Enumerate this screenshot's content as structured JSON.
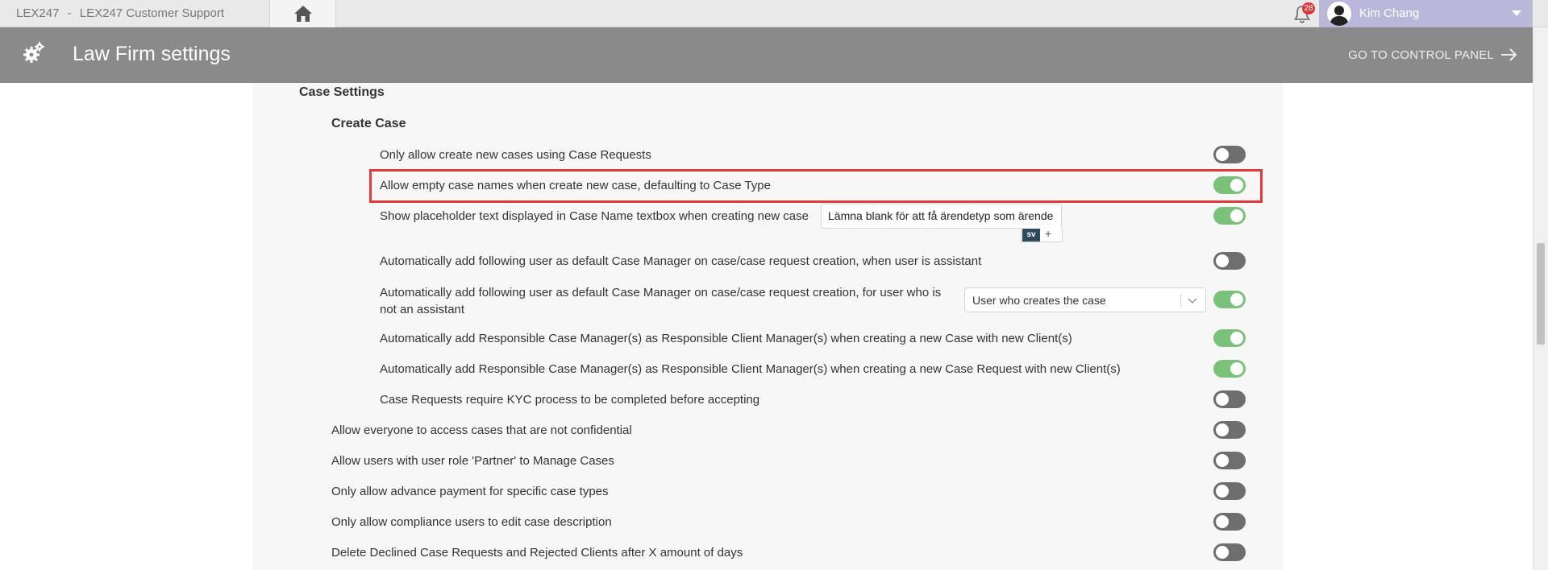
{
  "topbar": {
    "app_name": "LEX247",
    "separator": "-",
    "org_name": "LEX247 Customer Support",
    "notification_count": "28",
    "user_name": "Kim Chang"
  },
  "header": {
    "title": "Law Firm settings",
    "control_panel_label": "GO TO CONTROL PANEL"
  },
  "sections": {
    "case_settings": "Case Settings",
    "create_case": "Create Case"
  },
  "settings": [
    {
      "label": "Only allow create new cases using Case Requests",
      "enabled": false
    },
    {
      "label": "Allow empty case names when create new case, defaulting to Case Type",
      "enabled": true
    },
    {
      "label": "Show placeholder text displayed in Case Name textbox when creating new case",
      "enabled": true
    },
    {
      "label": "Automatically add following user as default Case Manager on case/case request creation, when user is assistant",
      "enabled": false
    },
    {
      "label": "Automatically add following user as default Case Manager on case/case request creation, for user who is not an assistant",
      "enabled": true
    },
    {
      "label": "Automatically add Responsible Case Manager(s) as Responsible Client Manager(s) when creating a new Case with new Client(s)",
      "enabled": true
    },
    {
      "label": "Automatically add Responsible Case Manager(s) as Responsible Client Manager(s) when creating a new Case Request with new Client(s)",
      "enabled": true
    },
    {
      "label": "Case Requests require KYC process to be completed before accepting",
      "enabled": false
    },
    {
      "label": "Allow everyone to access cases that are not confidential",
      "enabled": false
    },
    {
      "label": "Allow users with user role 'Partner' to Manage Cases",
      "enabled": false
    },
    {
      "label": "Only allow advance payment for specific case types",
      "enabled": false
    },
    {
      "label": "Only allow compliance users to edit case description",
      "enabled": false
    },
    {
      "label": "Delete Declined Case Requests and Rejected Clients after X amount of days",
      "enabled": false
    }
  ],
  "placeholder_input": {
    "value": "Lämna blank för att få ärendetyp som ärende",
    "language": "sv",
    "add_language": "+"
  },
  "case_manager_select": {
    "value": "User who creates the case"
  },
  "colors": {
    "toggle_on": "#7ac27a",
    "toggle_off": "#6e6e6e",
    "highlight": "#e5383b",
    "header_bg": "#8a8a8a",
    "user_area_bg": "#b9b8d8"
  },
  "icons": [
    "home-icon",
    "bell-icon",
    "user-avatar-icon",
    "caret-down-icon",
    "gears-icon",
    "arrow-right-icon",
    "chevron-down-icon"
  ]
}
